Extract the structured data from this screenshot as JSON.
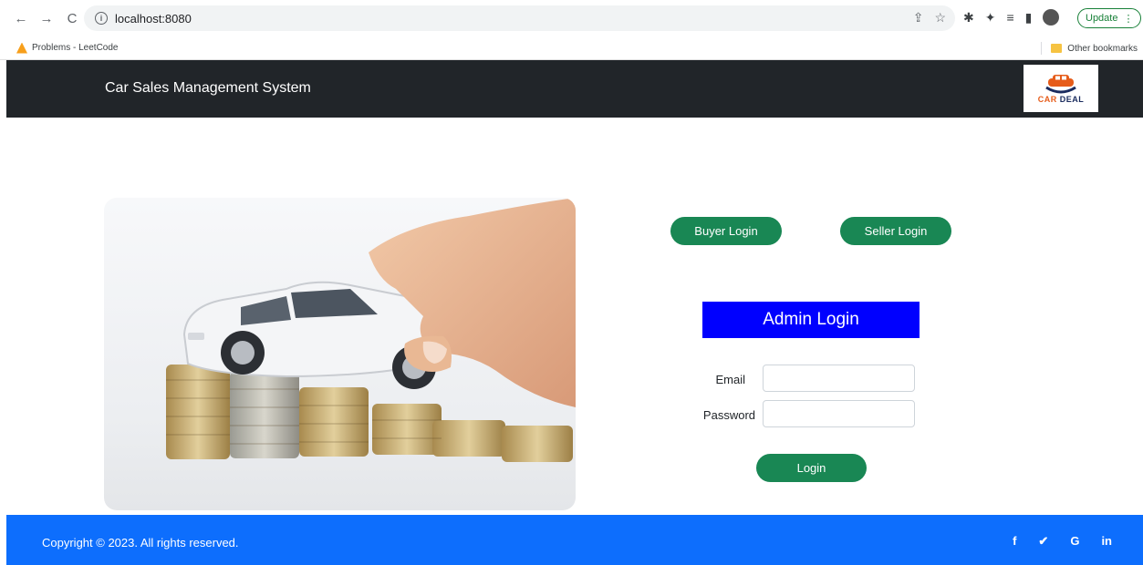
{
  "browser": {
    "url": "localhost:8080",
    "update_label": "Update",
    "bookmarks": [
      {
        "label": "Problems - LeetCode"
      }
    ],
    "other_bookmarks_label": "Other bookmarks"
  },
  "header": {
    "brand": "Car Sales Management System",
    "logo_text_car": "CAR",
    "logo_text_deal": "DEAL"
  },
  "main": {
    "buyer_login_label": "Buyer Login",
    "seller_login_label": "Seller Login",
    "admin_title": "Admin Login",
    "email_label": "Email",
    "email_value": "",
    "password_label": "Password",
    "password_value": "",
    "login_label": "Login"
  },
  "footer": {
    "copyright": "Copyright © 2023. All rights reserved.",
    "socials": [
      {
        "label": "f",
        "icon": "facebook-icon"
      },
      {
        "label": "𝕪",
        "icon": "twitter-icon"
      },
      {
        "label": "G",
        "icon": "google-icon"
      },
      {
        "label": "in",
        "icon": "linkedin-icon"
      }
    ]
  },
  "colors": {
    "header_bg": "#212529",
    "button_green": "#198754",
    "admin_title_bg": "#0000ff",
    "footer_bg": "#0d6efd"
  }
}
